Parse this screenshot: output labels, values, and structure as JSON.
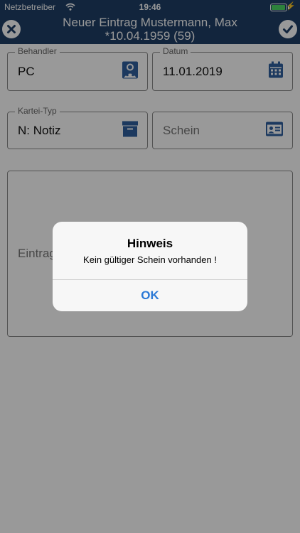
{
  "status_bar": {
    "carrier": "Netzbetreiber",
    "time": "19:46",
    "battery_level": 0.95,
    "battery_color": "#4cd964"
  },
  "nav": {
    "title": "Neuer Eintrag Mustermann, Max *10.04.1959 (59)",
    "left_icon": "close-icon",
    "right_icon": "checkmark-icon",
    "background": "#1f3f66"
  },
  "form": {
    "behandler": {
      "label": "Behandler",
      "value": "PC",
      "icon": "doctor-icon"
    },
    "datum": {
      "label": "Datum",
      "value": "11.01.2019",
      "icon": "calendar-icon"
    },
    "kartei_typ": {
      "label": "Kartei-Typ",
      "value": "N: Notiz",
      "icon": "archive-box-icon"
    },
    "schein": {
      "placeholder": "Schein",
      "icon": "id-card-icon"
    },
    "eintrag": {
      "placeholder": "Eintrag"
    }
  },
  "icon_color": "#2f5f9e",
  "alert": {
    "title": "Hinweis",
    "message": "Kein gültiger Schein vorhanden !",
    "button": "OK",
    "button_color": "#2b79d6"
  }
}
